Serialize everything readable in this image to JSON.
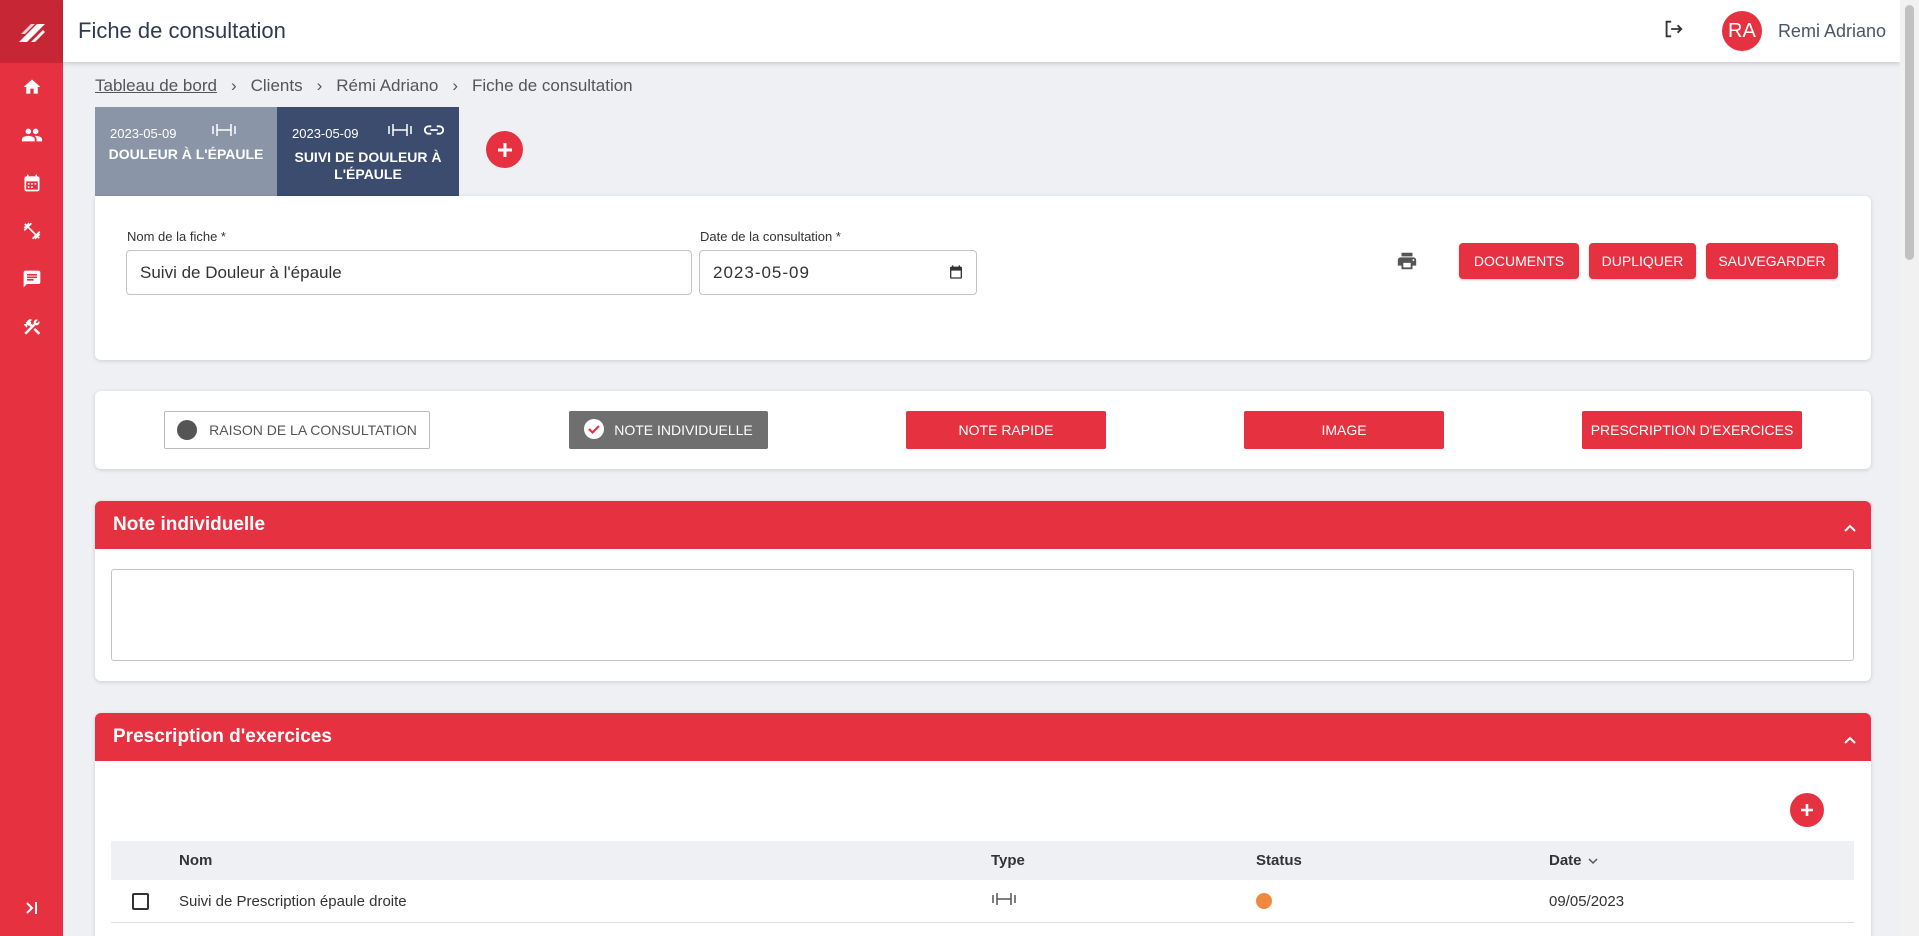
{
  "app": {
    "page_title": "Fiche de consultation",
    "user_initials": "RA",
    "user_name": "Remi Adriano"
  },
  "breadcrumb": {
    "items": [
      "Tableau de bord",
      "Clients",
      "Rémi Adriano",
      "Fiche de consultation"
    ]
  },
  "tabs": [
    {
      "date": "2023-05-09",
      "name": "DOULEUR À L'ÉPAULE"
    },
    {
      "date": "2023-05-09",
      "name": "SUIVI DE DOULEUR À L'ÉPAULE"
    }
  ],
  "form": {
    "name_label": "Nom de la fiche *",
    "name_value": "Suivi de Douleur à l'épaule",
    "date_label": "Date de la consultation *",
    "date_value": "2023-05-09",
    "btn_documents": "DOCUMENTS",
    "btn_dupliquer": "DUPLIQUER",
    "btn_sauvegarder": "SAUVEGARDER"
  },
  "sections": {
    "raison": "RAISON DE LA CONSULTATION",
    "note_individuelle": "NOTE INDIVIDUELLE",
    "note_rapide": "NOTE RAPIDE",
    "image": "IMAGE",
    "prescription": "PRESCRIPTION D'EXERCICES"
  },
  "note_panel": {
    "title": "Note individuelle",
    "value": ""
  },
  "prescription_panel": {
    "title": "Prescription d'exercices",
    "columns": {
      "nom": "Nom",
      "type": "Type",
      "status": "Status",
      "date": "Date"
    },
    "rows": [
      {
        "nom": "Suivi de Prescription épaule droite",
        "date": "09/05/2023",
        "status_color": "#f0883e"
      }
    ]
  },
  "colors": {
    "accent": "#e63140",
    "tab_inactive": "#8a95a7",
    "tab_active": "#3b4c6e",
    "status_pending": "#f0883e"
  }
}
